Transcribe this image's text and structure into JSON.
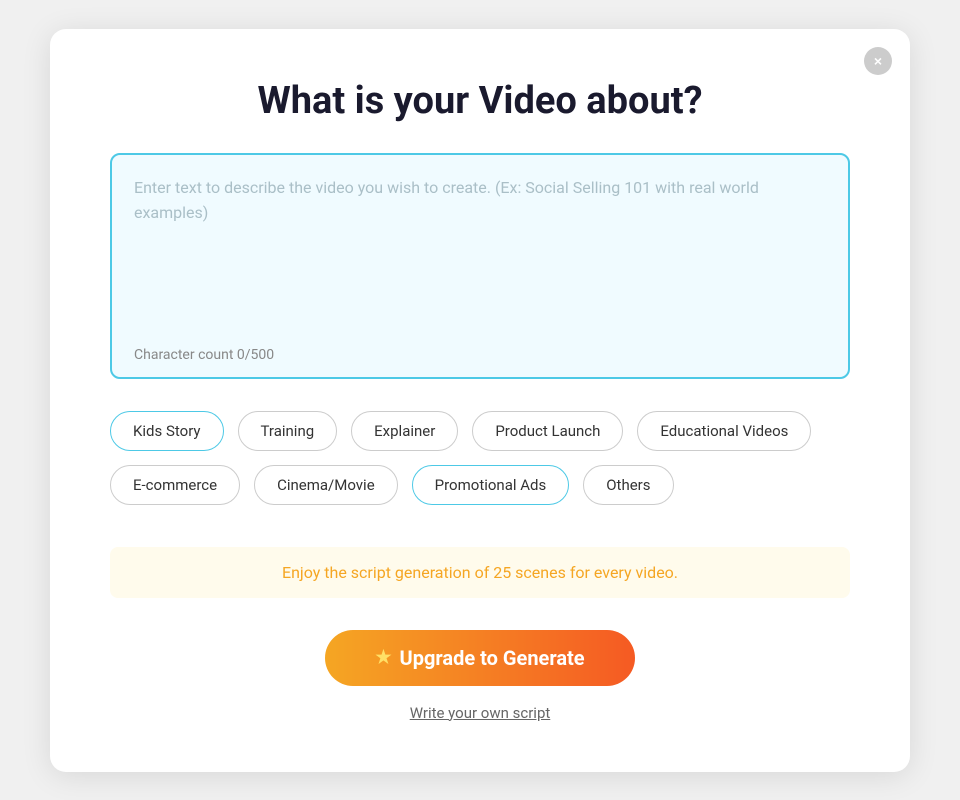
{
  "modal": {
    "title": "What is your Video about?",
    "close_label": "×"
  },
  "textarea": {
    "placeholder": "Enter text to describe the video you wish to create. (Ex: Social Selling 101 with real world examples)",
    "char_count_label": "Character count 0/500",
    "value": ""
  },
  "tags": {
    "row1": [
      {
        "label": "Kids Story",
        "active": true
      },
      {
        "label": "Training",
        "active": false
      },
      {
        "label": "Explainer",
        "active": false
      },
      {
        "label": "Product Launch",
        "active": false
      },
      {
        "label": "Educational Videos",
        "active": false
      }
    ],
    "row2": [
      {
        "label": "E-commerce",
        "active": false
      },
      {
        "label": "Cinema/Movie",
        "active": false
      },
      {
        "label": "Promotional Ads",
        "active": true
      },
      {
        "label": "Others",
        "active": false
      }
    ]
  },
  "notice": {
    "text": "Enjoy the script generation of 25 scenes for every video."
  },
  "upgrade_button": {
    "star": "★",
    "label": "Upgrade to Generate"
  },
  "own_script_link": "Write your own script"
}
